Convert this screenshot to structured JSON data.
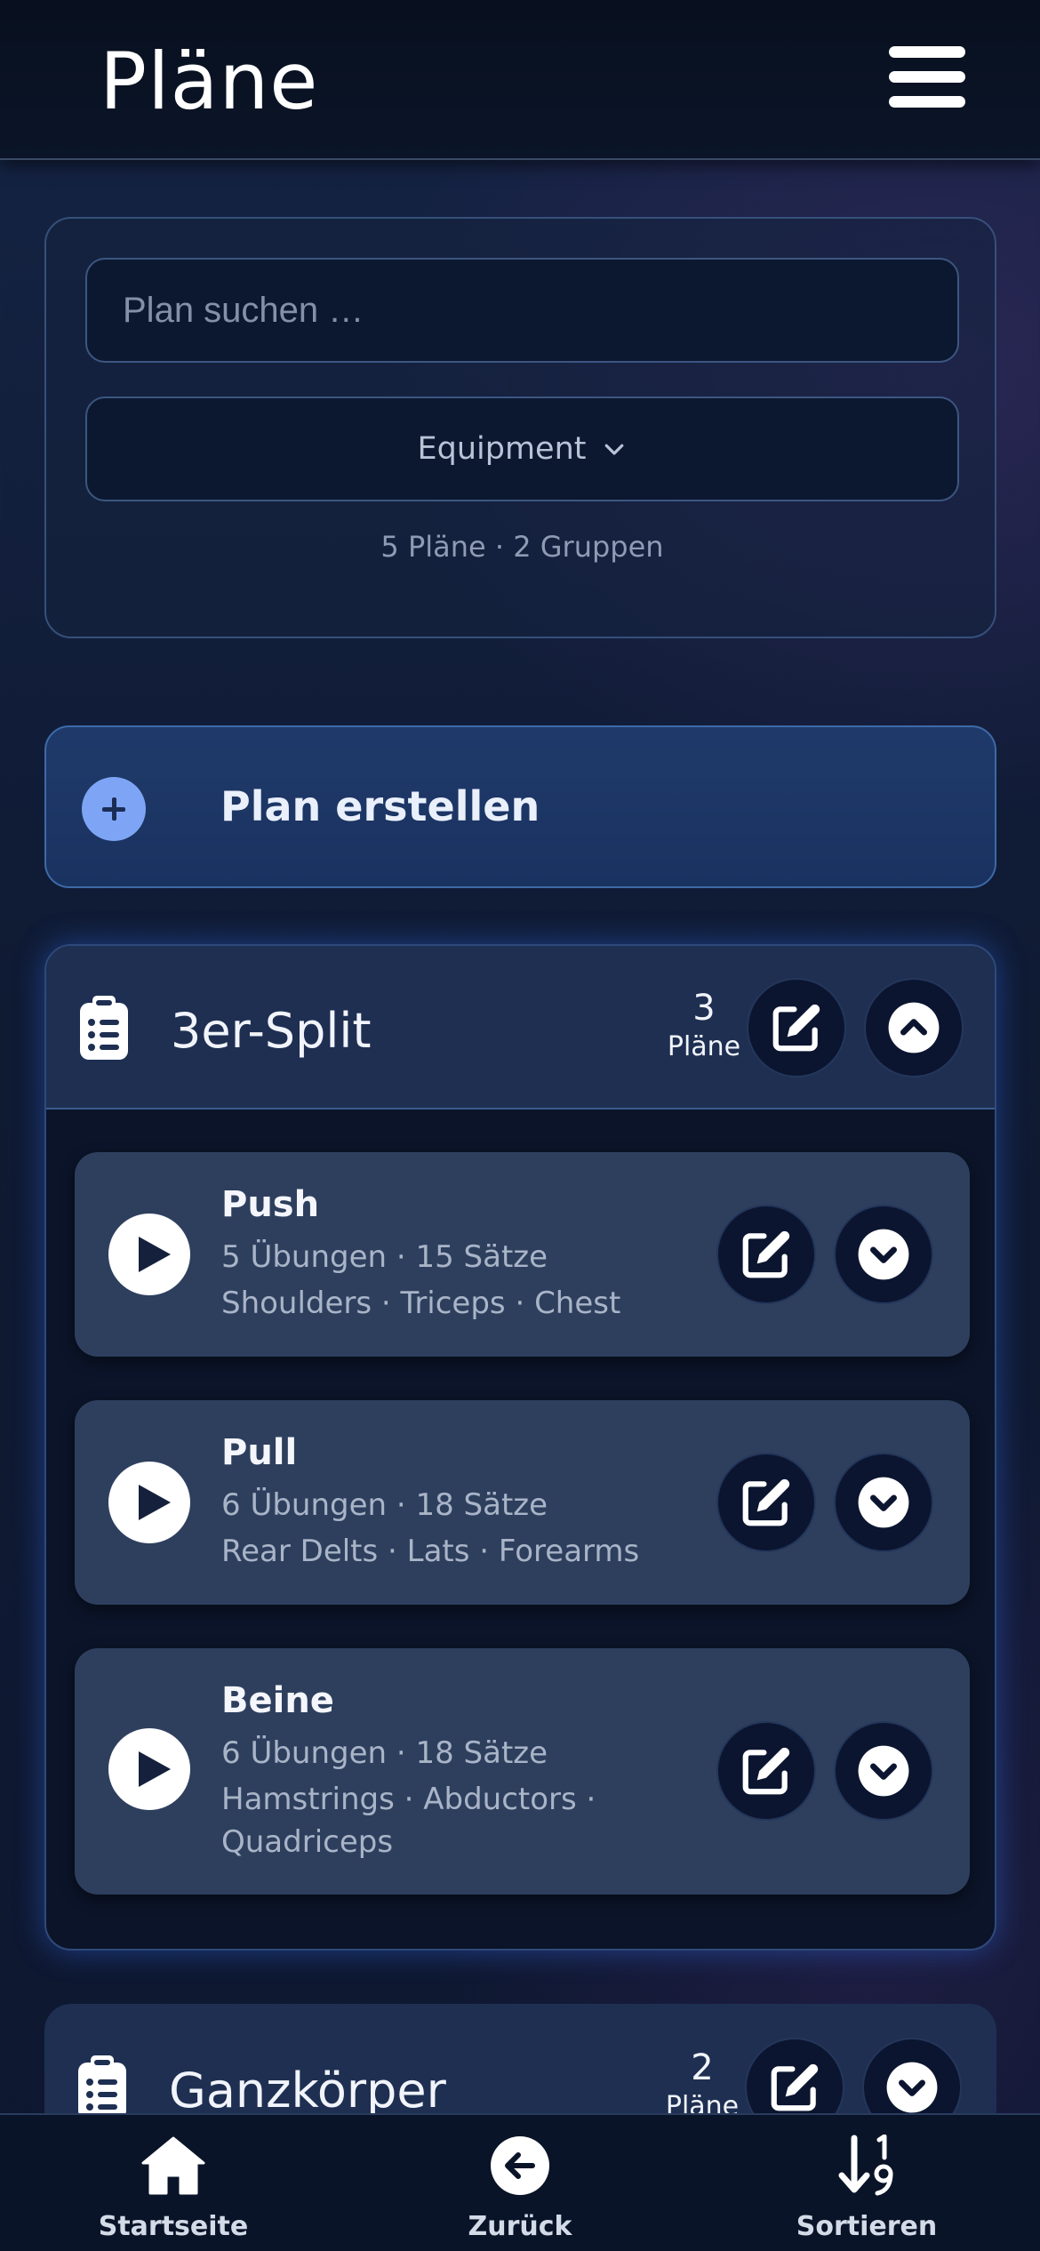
{
  "header": {
    "title": "Pläne"
  },
  "filters": {
    "search_placeholder": "Plan suchen …",
    "equipment_label": "Equipment",
    "summary": "5 Pläne · 2 Gruppen"
  },
  "create": {
    "label": "Plan erstellen"
  },
  "groups": [
    {
      "title": "3er-Split",
      "count": "3",
      "count_unit": "Pläne",
      "expanded": true,
      "plans": [
        {
          "name": "Push",
          "meta": "5 Übungen · 15 Sätze",
          "muscles": "Shoulders · Triceps · Chest"
        },
        {
          "name": "Pull",
          "meta": "6 Übungen · 18 Sätze",
          "muscles": "Rear Delts · Lats · Forearms"
        },
        {
          "name": "Beine",
          "meta": "6 Übungen · 18 Sätze",
          "muscles": "Hamstrings · Abductors · Quadriceps"
        }
      ]
    },
    {
      "title": "Ganzkörper",
      "count": "2",
      "count_unit": "Pläne",
      "expanded": false
    }
  ],
  "bottom_nav": [
    {
      "label": "Startseite",
      "icon": "home-icon"
    },
    {
      "label": "Zurück",
      "icon": "arrow-left-circle-icon"
    },
    {
      "label": "Sortieren",
      "icon": "sort-numeric-icon"
    }
  ],
  "colors": {
    "background": "#0f1a33",
    "card": "#1e2f52",
    "plan_item": "#2e3f5e",
    "accent": "#7ea5f5",
    "glow": "#3270f0"
  }
}
